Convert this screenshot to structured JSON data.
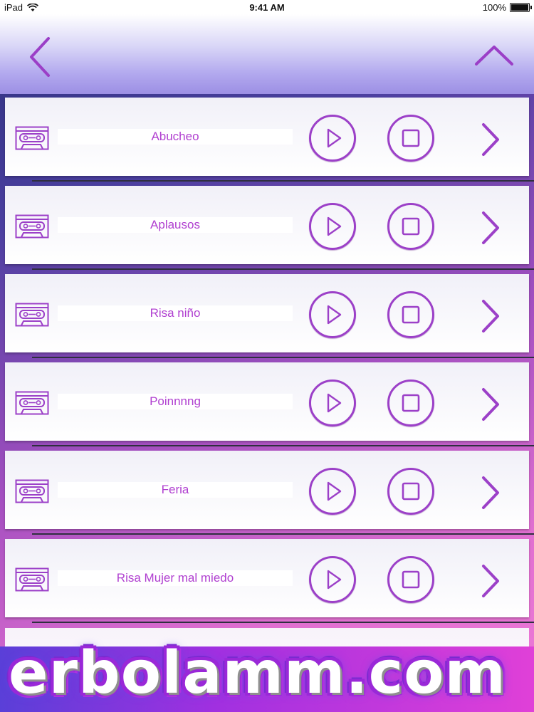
{
  "status_bar": {
    "device": "iPad",
    "time": "9:41 AM",
    "battery": "100%"
  },
  "nav": {
    "back_icon": "chevron-left-icon",
    "up_icon": "chevron-up-icon"
  },
  "colors": {
    "accent": "#9c40c8",
    "label": "#b03fd0"
  },
  "sounds": [
    {
      "name": "Abucheo"
    },
    {
      "name": "Aplausos"
    },
    {
      "name": "Risa niño"
    },
    {
      "name": "Poinnnng"
    },
    {
      "name": "Feria"
    },
    {
      "name": "Risa Mujer mal miedo"
    }
  ],
  "watermark": {
    "text": "erbolamm.com"
  }
}
